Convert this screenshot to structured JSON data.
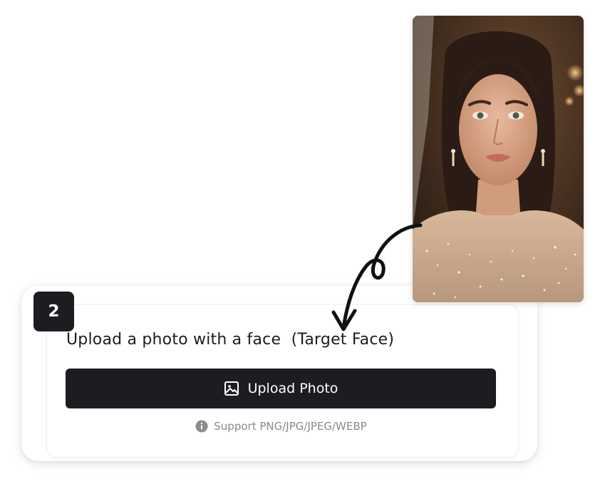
{
  "step": {
    "number": "2"
  },
  "title": "Upload a photo with a face  (Target Face)",
  "upload_button": {
    "label": "Upload Photo",
    "icon": "image-icon"
  },
  "support": {
    "icon": "info-icon",
    "text": "Support PNG/JPG/JPEG/WEBP"
  },
  "example_photo": {
    "icon": "portrait-photo",
    "colors": {
      "background": "#3a2a1e",
      "skin": "#d9a88a",
      "hair": "#2a1c14",
      "dress": "#c9a98c"
    }
  },
  "colors": {
    "dark": "#1d1d21",
    "muted": "#8a8a8f",
    "card_bg": "#ffffff"
  }
}
